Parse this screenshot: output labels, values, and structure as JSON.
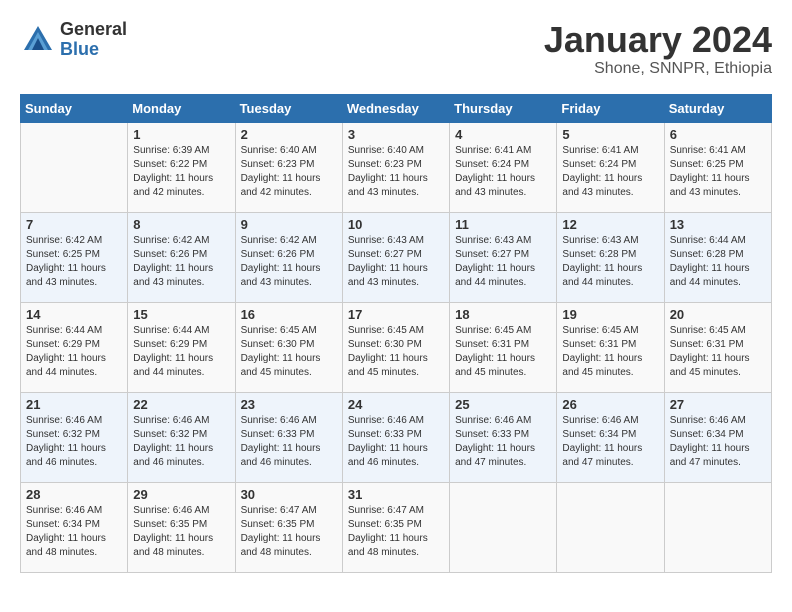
{
  "header": {
    "logo_general": "General",
    "logo_blue": "Blue",
    "month": "January 2024",
    "location": "Shone, SNNPR, Ethiopia"
  },
  "days_of_week": [
    "Sunday",
    "Monday",
    "Tuesday",
    "Wednesday",
    "Thursday",
    "Friday",
    "Saturday"
  ],
  "weeks": [
    [
      {
        "num": "",
        "info": ""
      },
      {
        "num": "1",
        "info": "Sunrise: 6:39 AM\nSunset: 6:22 PM\nDaylight: 11 hours\nand 42 minutes."
      },
      {
        "num": "2",
        "info": "Sunrise: 6:40 AM\nSunset: 6:23 PM\nDaylight: 11 hours\nand 42 minutes."
      },
      {
        "num": "3",
        "info": "Sunrise: 6:40 AM\nSunset: 6:23 PM\nDaylight: 11 hours\nand 43 minutes."
      },
      {
        "num": "4",
        "info": "Sunrise: 6:41 AM\nSunset: 6:24 PM\nDaylight: 11 hours\nand 43 minutes."
      },
      {
        "num": "5",
        "info": "Sunrise: 6:41 AM\nSunset: 6:24 PM\nDaylight: 11 hours\nand 43 minutes."
      },
      {
        "num": "6",
        "info": "Sunrise: 6:41 AM\nSunset: 6:25 PM\nDaylight: 11 hours\nand 43 minutes."
      }
    ],
    [
      {
        "num": "7",
        "info": "Sunrise: 6:42 AM\nSunset: 6:25 PM\nDaylight: 11 hours\nand 43 minutes."
      },
      {
        "num": "8",
        "info": "Sunrise: 6:42 AM\nSunset: 6:26 PM\nDaylight: 11 hours\nand 43 minutes."
      },
      {
        "num": "9",
        "info": "Sunrise: 6:42 AM\nSunset: 6:26 PM\nDaylight: 11 hours\nand 43 minutes."
      },
      {
        "num": "10",
        "info": "Sunrise: 6:43 AM\nSunset: 6:27 PM\nDaylight: 11 hours\nand 43 minutes."
      },
      {
        "num": "11",
        "info": "Sunrise: 6:43 AM\nSunset: 6:27 PM\nDaylight: 11 hours\nand 44 minutes."
      },
      {
        "num": "12",
        "info": "Sunrise: 6:43 AM\nSunset: 6:28 PM\nDaylight: 11 hours\nand 44 minutes."
      },
      {
        "num": "13",
        "info": "Sunrise: 6:44 AM\nSunset: 6:28 PM\nDaylight: 11 hours\nand 44 minutes."
      }
    ],
    [
      {
        "num": "14",
        "info": "Sunrise: 6:44 AM\nSunset: 6:29 PM\nDaylight: 11 hours\nand 44 minutes."
      },
      {
        "num": "15",
        "info": "Sunrise: 6:44 AM\nSunset: 6:29 PM\nDaylight: 11 hours\nand 44 minutes."
      },
      {
        "num": "16",
        "info": "Sunrise: 6:45 AM\nSunset: 6:30 PM\nDaylight: 11 hours\nand 45 minutes."
      },
      {
        "num": "17",
        "info": "Sunrise: 6:45 AM\nSunset: 6:30 PM\nDaylight: 11 hours\nand 45 minutes."
      },
      {
        "num": "18",
        "info": "Sunrise: 6:45 AM\nSunset: 6:31 PM\nDaylight: 11 hours\nand 45 minutes."
      },
      {
        "num": "19",
        "info": "Sunrise: 6:45 AM\nSunset: 6:31 PM\nDaylight: 11 hours\nand 45 minutes."
      },
      {
        "num": "20",
        "info": "Sunrise: 6:45 AM\nSunset: 6:31 PM\nDaylight: 11 hours\nand 45 minutes."
      }
    ],
    [
      {
        "num": "21",
        "info": "Sunrise: 6:46 AM\nSunset: 6:32 PM\nDaylight: 11 hours\nand 46 minutes."
      },
      {
        "num": "22",
        "info": "Sunrise: 6:46 AM\nSunset: 6:32 PM\nDaylight: 11 hours\nand 46 minutes."
      },
      {
        "num": "23",
        "info": "Sunrise: 6:46 AM\nSunset: 6:33 PM\nDaylight: 11 hours\nand 46 minutes."
      },
      {
        "num": "24",
        "info": "Sunrise: 6:46 AM\nSunset: 6:33 PM\nDaylight: 11 hours\nand 46 minutes."
      },
      {
        "num": "25",
        "info": "Sunrise: 6:46 AM\nSunset: 6:33 PM\nDaylight: 11 hours\nand 47 minutes."
      },
      {
        "num": "26",
        "info": "Sunrise: 6:46 AM\nSunset: 6:34 PM\nDaylight: 11 hours\nand 47 minutes."
      },
      {
        "num": "27",
        "info": "Sunrise: 6:46 AM\nSunset: 6:34 PM\nDaylight: 11 hours\nand 47 minutes."
      }
    ],
    [
      {
        "num": "28",
        "info": "Sunrise: 6:46 AM\nSunset: 6:34 PM\nDaylight: 11 hours\nand 48 minutes."
      },
      {
        "num": "29",
        "info": "Sunrise: 6:46 AM\nSunset: 6:35 PM\nDaylight: 11 hours\nand 48 minutes."
      },
      {
        "num": "30",
        "info": "Sunrise: 6:47 AM\nSunset: 6:35 PM\nDaylight: 11 hours\nand 48 minutes."
      },
      {
        "num": "31",
        "info": "Sunrise: 6:47 AM\nSunset: 6:35 PM\nDaylight: 11 hours\nand 48 minutes."
      },
      {
        "num": "",
        "info": ""
      },
      {
        "num": "",
        "info": ""
      },
      {
        "num": "",
        "info": ""
      }
    ]
  ]
}
